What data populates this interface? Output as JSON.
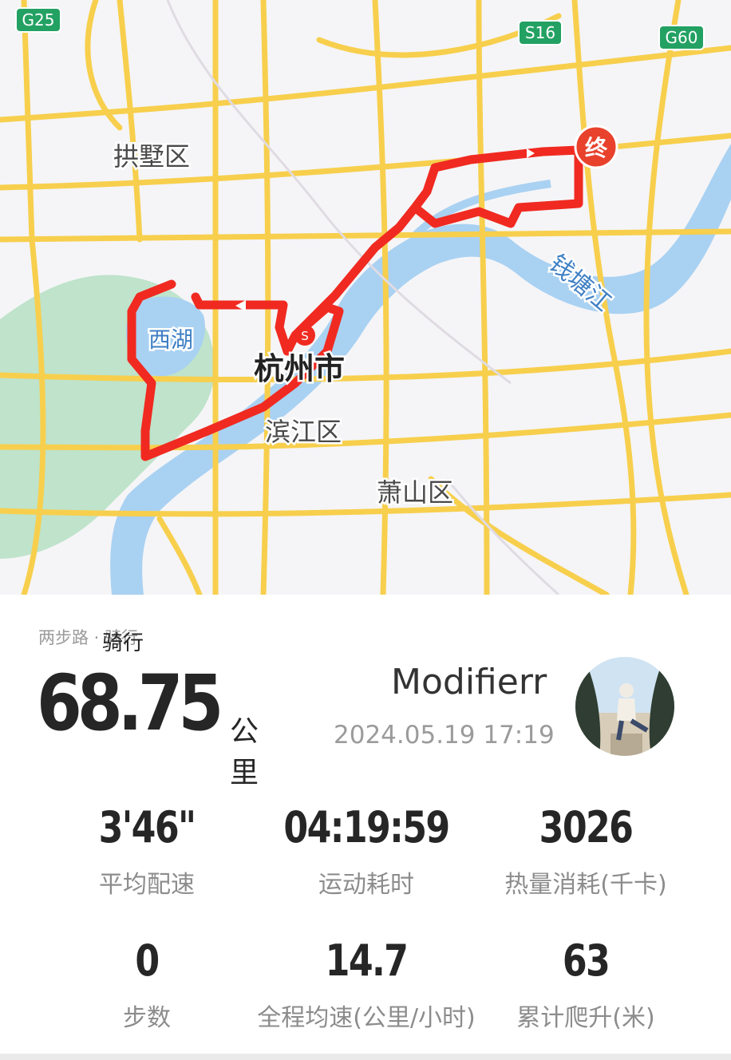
{
  "map": {
    "district_labels": [
      "拱墅区",
      "西湖",
      "杭州市",
      "滨江区",
      "萧山区",
      "钱塘江"
    ],
    "highway_shields": [
      "G25",
      "S16",
      "G60"
    ],
    "end_marker": "终",
    "start_marker": "S",
    "colors": {
      "road": "#f7cf4d",
      "water": "#a9d1f2",
      "park": "#b5e0c3",
      "route": "#f02a21",
      "land": "#f5f5f7"
    }
  },
  "activity": {
    "source_label": "两步路 · 骑行",
    "type_label": "骑行",
    "distance_value": "68.75",
    "distance_unit": "公里",
    "user_name": "Modifierr",
    "datetime": "2024.05.19 17:19"
  },
  "stats": [
    {
      "value": "3'46\"",
      "label": "平均配速"
    },
    {
      "value": "04:19:59",
      "label": "运动耗时"
    },
    {
      "value": "3026",
      "label": "热量消耗(千卡)"
    },
    {
      "value": "0",
      "label": "步数"
    },
    {
      "value": "14.7",
      "label": "全程均速(公里/小时)"
    },
    {
      "value": "63",
      "label": "累计爬升(米)"
    }
  ]
}
